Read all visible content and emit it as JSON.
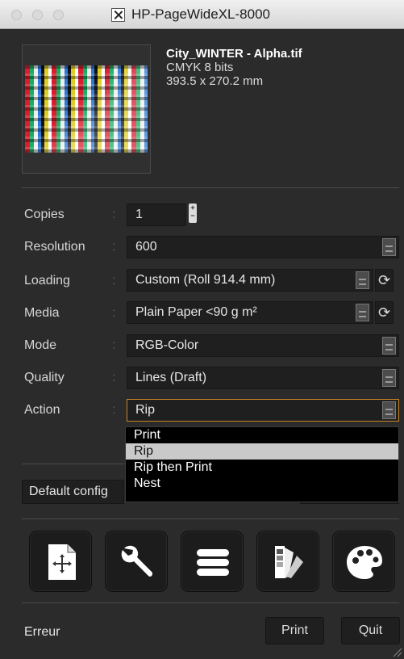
{
  "window": {
    "title": "HP-PageWideXL-8000"
  },
  "file": {
    "name": "City_WINTER - Alpha.tif",
    "color": "CMYK 8 bits",
    "size": "393.5 x 270.2 mm"
  },
  "form": {
    "colon": ":",
    "copies": {
      "label": "Copies",
      "value": "1"
    },
    "resolution": {
      "label": "Resolution",
      "value": "600"
    },
    "loading": {
      "label": "Loading",
      "value": "Custom (Roll 914.4 mm)"
    },
    "media": {
      "label": "Media",
      "value": "Plain Paper  <90 g m²"
    },
    "mode": {
      "label": "Mode",
      "value": "RGB-Color"
    },
    "quality": {
      "label": "Quality",
      "value": "Lines (Draft)"
    },
    "action": {
      "label": "Action",
      "value": "Rip"
    }
  },
  "action_menu": {
    "options": [
      "Print",
      "Rip",
      "Rip then Print",
      "Nest"
    ],
    "selected": "Rip"
  },
  "config": {
    "value": "Default config"
  },
  "toolbar": {
    "icons": [
      "move-icon",
      "wrench-icon",
      "menu-icon",
      "color-swatch-icon",
      "palette-icon"
    ]
  },
  "footer": {
    "status": "Erreur",
    "print_label": "Print",
    "quit_label": "Quit"
  },
  "colors": {
    "background": "#2b2b2b",
    "field": "#1f1f1f",
    "focus_border": "#c8862a",
    "selection": "#c9c9c9"
  }
}
